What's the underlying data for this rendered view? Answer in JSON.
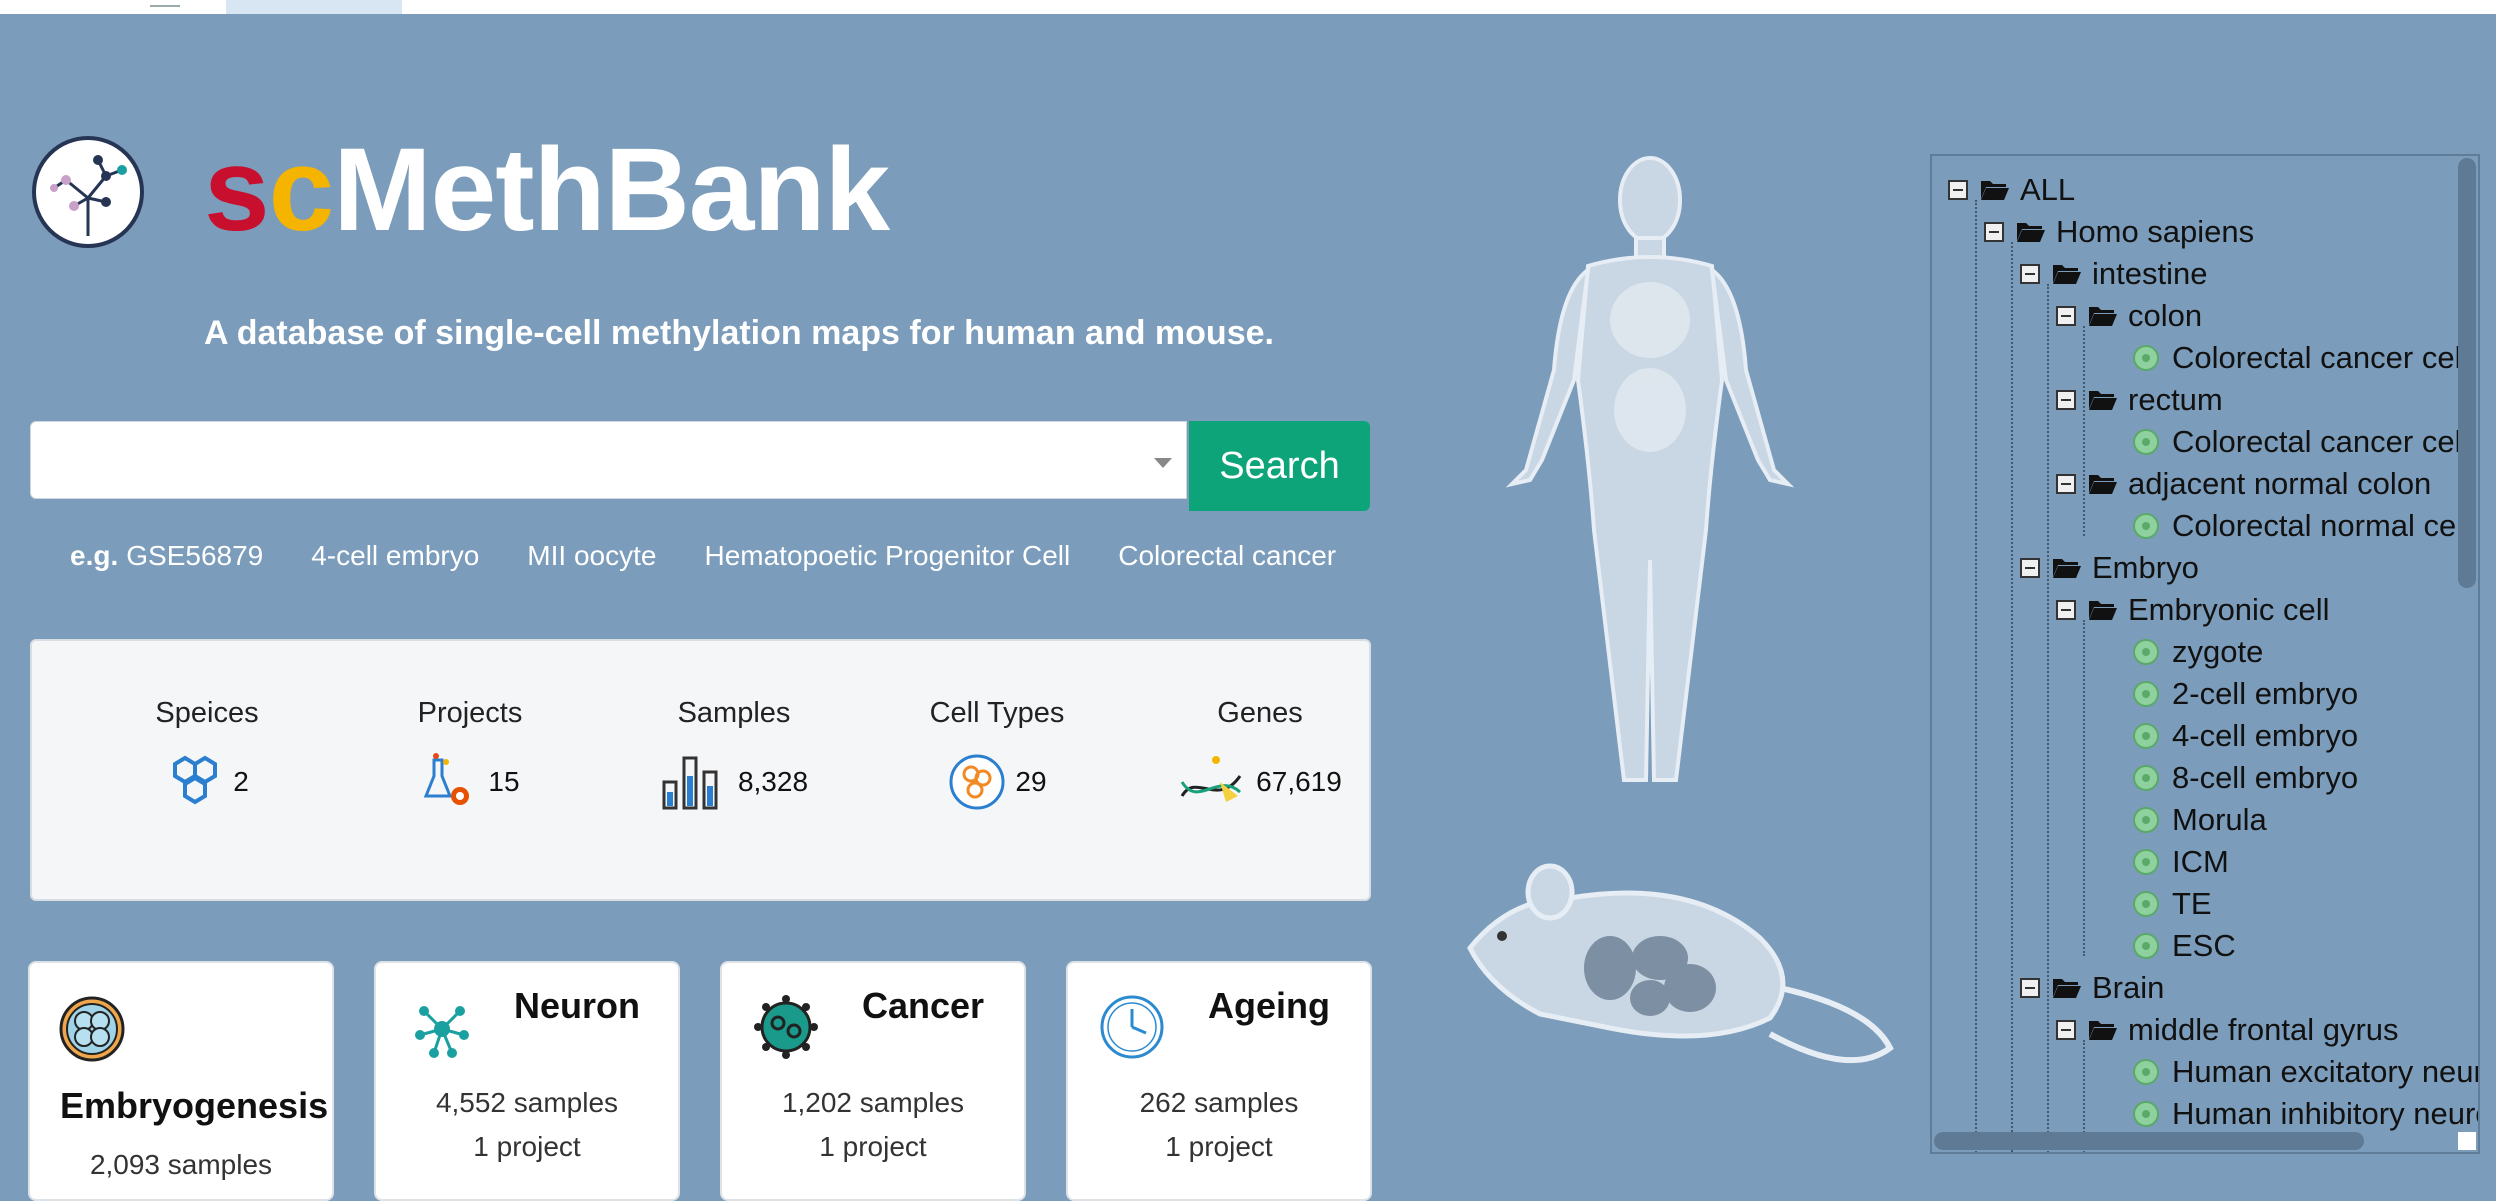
{
  "brand": {
    "s": "s",
    "c": "c",
    "rest": "MethBank"
  },
  "tagline": "A database of single-cell methylation maps for human and mouse.",
  "search": {
    "placeholder": "",
    "button_label": "Search"
  },
  "examples": {
    "lead": "e.g.",
    "items": [
      "GSE56879",
      "4-cell embryo",
      "MII oocyte",
      "Hematopoetic Progenitor Cell",
      "Colorectal cancer"
    ]
  },
  "stats": [
    {
      "label": "Speices",
      "value": "2",
      "icon": "hexagon-cluster-icon"
    },
    {
      "label": "Projects",
      "value": "15",
      "icon": "flask-gear-icon"
    },
    {
      "label": "Samples",
      "value": "8,328",
      "icon": "test-tubes-icon"
    },
    {
      "label": "Cell Types",
      "value": "29",
      "icon": "cells-icon"
    },
    {
      "label": "Genes",
      "value": "67,619",
      "icon": "dna-icon"
    }
  ],
  "cards": [
    {
      "title": "Embryogenesis",
      "samples": "2,093 samples",
      "project": "",
      "icon": "embryo-icon"
    },
    {
      "title": "Neuron",
      "samples": "4,552 samples",
      "project": "1 project",
      "icon": "neuron-network-icon"
    },
    {
      "title": "Cancer",
      "samples": "1,202 samples",
      "project": "1 project",
      "icon": "cancer-cell-icon"
    },
    {
      "title": "Ageing",
      "samples": "262 samples",
      "project": "1 project",
      "icon": "clock-icon"
    }
  ],
  "tree": [
    {
      "label": "ALL",
      "type": "folder"
    },
    {
      "label": "Homo sapiens",
      "type": "folder"
    },
    {
      "label": "intestine",
      "type": "folder"
    },
    {
      "label": "colon",
      "type": "folder"
    },
    {
      "label": "Colorectal cancer cell",
      "type": "leaf"
    },
    {
      "label": "rectum",
      "type": "folder"
    },
    {
      "label": "Colorectal cancer cell",
      "type": "leaf"
    },
    {
      "label": "adjacent normal colon",
      "type": "folder"
    },
    {
      "label": "Colorectal normal cell",
      "type": "leaf"
    },
    {
      "label": "Embryo",
      "type": "folder"
    },
    {
      "label": "Embryonic cell",
      "type": "folder"
    },
    {
      "label": "zygote",
      "type": "leaf"
    },
    {
      "label": "2-cell embryo",
      "type": "leaf"
    },
    {
      "label": "4-cell embryo",
      "type": "leaf"
    },
    {
      "label": "8-cell embryo",
      "type": "leaf"
    },
    {
      "label": "Morula",
      "type": "leaf"
    },
    {
      "label": "ICM",
      "type": "leaf"
    },
    {
      "label": "TE",
      "type": "leaf"
    },
    {
      "label": "ESC",
      "type": "leaf"
    },
    {
      "label": "Brain",
      "type": "folder"
    },
    {
      "label": "middle frontal gyrus",
      "type": "folder"
    },
    {
      "label": "Human excitatory neuron",
      "type": "leaf"
    },
    {
      "label": "Human inhibitory neuron",
      "type": "leaf"
    }
  ]
}
